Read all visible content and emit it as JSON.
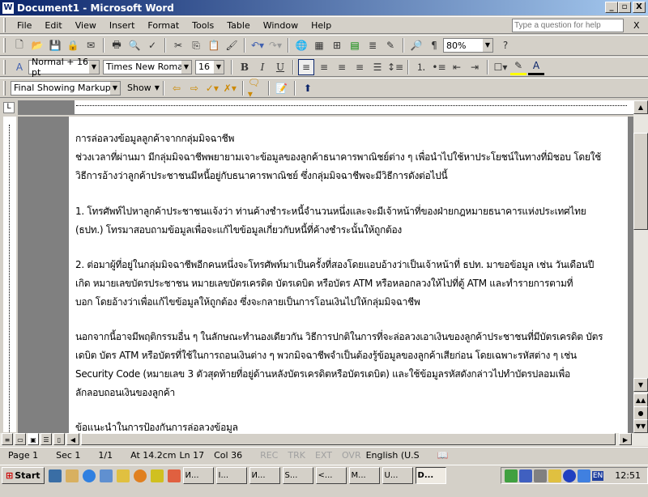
{
  "window": {
    "title": "Document1 - Microsoft Word",
    "min": "_",
    "max": "▫",
    "close": "X"
  },
  "menu": {
    "items": [
      "File",
      "Edit",
      "View",
      "Insert",
      "Format",
      "Tools",
      "Table",
      "Window",
      "Help"
    ],
    "help_placeholder": "Type a question for help",
    "close": "X"
  },
  "standard": {
    "zoom": "80%"
  },
  "formatting": {
    "style": "Normal + 16 pt",
    "font": "Times New Roman",
    "size": "16",
    "bold": "B",
    "italic": "I",
    "underline": "U"
  },
  "reviewing": {
    "display": "Final Showing Markup",
    "show": "Show"
  },
  "document": {
    "lines": [
      "การล่อลวงข้อมูลลูกค้าจากกลุ่มมิจฉาชีพ",
      "ช่วงเวลาที่ผ่านมา มีกลุ่มมิจฉาชีพพยายามเจาะข้อมูลของลูกค้าธนาคารพาณิชย์ต่าง ๆ เพื่อนำไปใช้หาประโยชน์ในทางที่มิชอบ โดยใช้",
      "วิธีการอ้างว่าลูกค้าประชาชนมีหนี้อยู่กับธนาคารพาณิชย์ ซึ่งกลุ่มมิจฉาชีพจะมีวิธีการดังต่อไปนี้",
      "1. โทรศัพท์ไปหาลูกค้าประชาชนแจ้งว่า ท่านค้างชำระหนี้จำนวนหนึ่งและจะมีเจ้าหน้าที่ของฝ่ายกฎหมายธนาคารแห่งประเทศไทย",
      "(ธปท.) โทรมาสอบถามข้อมูลเพื่อจะแก้ไขข้อมูลเกี่ยวกับหนี้ที่ค้างชำระนั้นให้ถูกต้อง",
      "2. ต่อมาผู้ที่อยู่ในกลุ่มมิจฉาชีพอีกคนหนึ่งจะโทรศัพท์มาเป็นครั้งที่สองโดยแอบอ้างว่าเป็นเจ้าหน้าที่ ธปท. มาขอข้อมูล เช่น วันเดือนปี",
      "เกิด หมายเลขบัตรประชาชน หมายเลขบัตรเครดิต บัตรเดบิต หรือบัตร ATM หรือหลอกลวงให้ไปที่ตู้ ATM และทำรายการตามที่",
      "บอก โดยอ้างว่าเพื่อแก้ไขข้อมูลให้ถูกต้อง ซึ่งจะกลายเป็นการโอนเงินไปให้กลุ่มมิจฉาชีพ",
      "นอกจากนี้อาจมีพฤติกรรมอื่น ๆ ในลักษณะทำนองเดียวกัน วิธีการปกติในการที่จะล่อลวงเอาเงินของลูกค้าประชาชนที่มีบัตรเครดิต บัตร",
      "เดบิต บัตร ATM หรือบัตรที่ใช้ในการถอนเงินต่าง ๆ พวกมิจฉาชีพจำเป็นต้องรู้ข้อมูลของลูกค้าเสียก่อน โดยเฉพาะรหัสต่าง ๆ เช่น",
      "Security Code (หมายเลข 3 ตัวสุดท้ายที่อยู่ด้านหลังบัตรเครดิตหรือบัตรเดบิต) และใช้ข้อมูลรหัสดังกล่าวไปทำบัตรปลอมเพื่อ",
      "ลักลอบถอนเงินของลูกค้า",
      "ข้อแนะนำในการป้องกันการล่อลวงข้อมูล"
    ]
  },
  "status": {
    "page": "Page 1",
    "sec": "Sec 1",
    "pages": "1/1",
    "at": "At 14.2cm",
    "ln": "Ln 17",
    "col": "Col 36",
    "rec": "REC",
    "trk": "TRK",
    "ext": "EXT",
    "ovr": "OVR",
    "lang": "English (U.S"
  },
  "taskbar": {
    "start": "Start",
    "tasks": [
      "И...",
      "I...",
      "И...",
      "S...",
      "<...",
      "M...",
      "U...",
      "D..."
    ],
    "tray_lang": "EN",
    "clock": "12:51"
  }
}
